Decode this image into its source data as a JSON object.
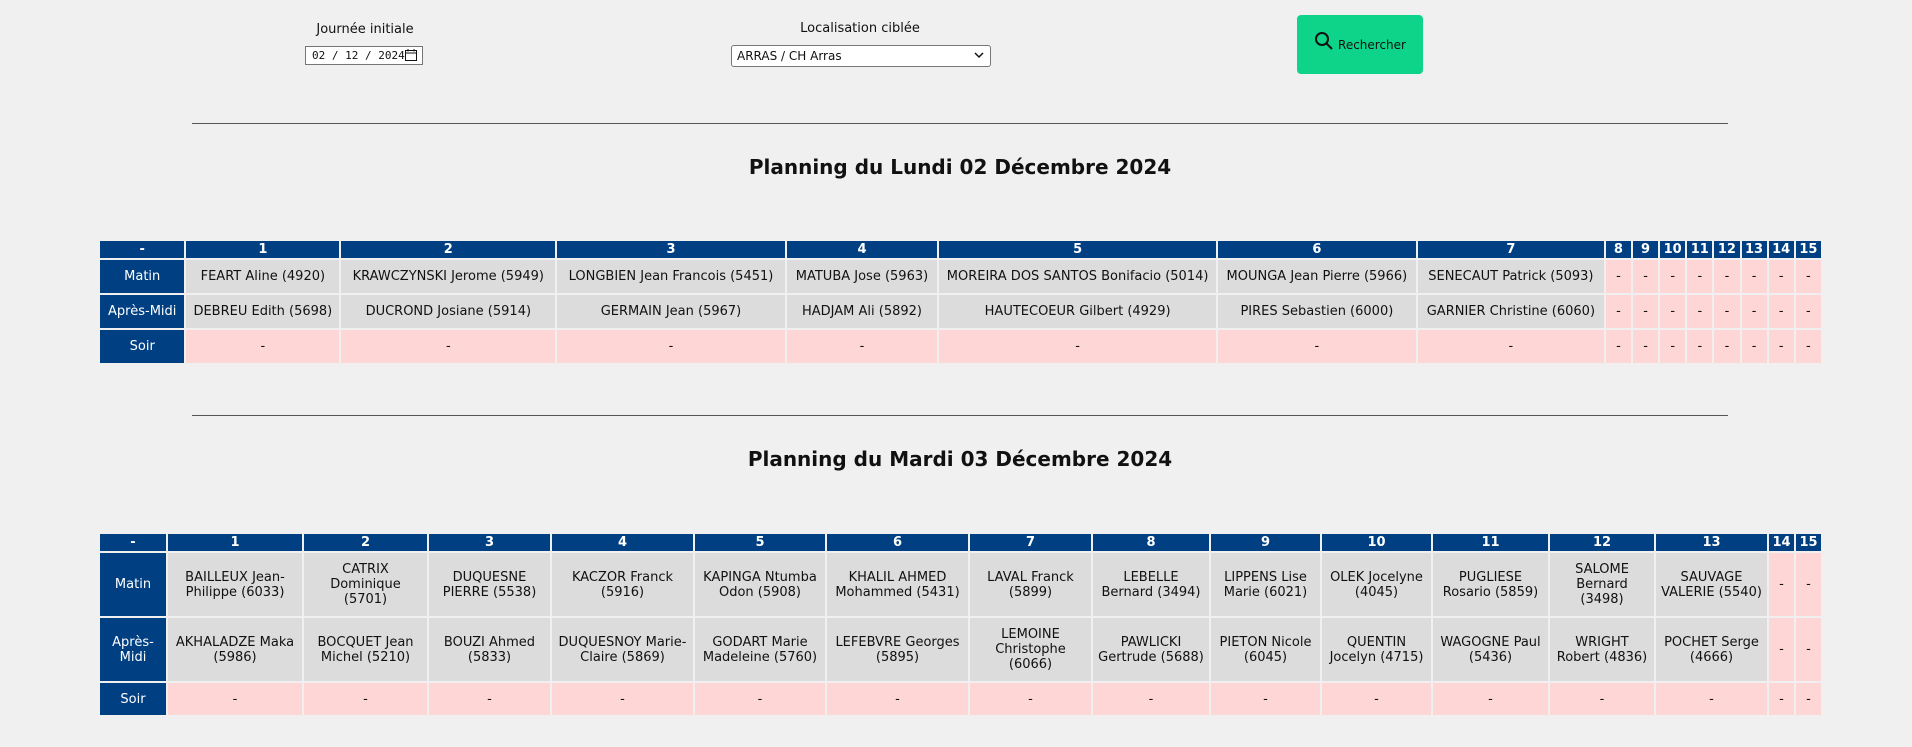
{
  "filters": {
    "date_label": "Journée initiale",
    "date_value": "02 / 12 / 2024",
    "location_label": "Localisation ciblée",
    "location_value": "ARRAS / CH Arras",
    "search_label": "Rechercher"
  },
  "plannings": [
    {
      "title": "Planning du Lundi 02 Décembre 2024",
      "corner": "-",
      "columns": [
        "1",
        "2",
        "3",
        "4",
        "5",
        "6",
        "7",
        "8",
        "9",
        "10",
        "11",
        "12",
        "13",
        "14",
        "15"
      ],
      "col_widths": [
        152,
        213,
        226,
        150,
        275,
        197,
        185,
        25,
        25,
        25,
        25,
        25,
        25,
        25,
        25
      ],
      "rows": [
        {
          "label": "Matin",
          "cells": [
            "FEART Aline (4920)",
            "KRAWCZYNSKI Jerome (5949)",
            "LONGBIEN Jean Francois (5451)",
            "MATUBA Jose (5963)",
            "MOREIRA DOS SANTOS Bonifacio (5014)",
            "MOUNGA Jean Pierre (5966)",
            "SENECAUT Patrick (5093)",
            "-",
            "-",
            "-",
            "-",
            "-",
            "-",
            "-",
            "-"
          ]
        },
        {
          "label": "Après-Midi",
          "cells": [
            "DEBREU Edith (5698)",
            "DUCROND Josiane (5914)",
            "GERMAIN Jean (5967)",
            "HADJAM Ali (5892)",
            "HAUTECOEUR Gilbert (4929)",
            "PIRES Sebastien (6000)",
            "GARNIER Christine (6060)",
            "-",
            "-",
            "-",
            "-",
            "-",
            "-",
            "-",
            "-"
          ]
        },
        {
          "label": "Soir",
          "cells": [
            "-",
            "-",
            "-",
            "-",
            "-",
            "-",
            "-",
            "-",
            "-",
            "-",
            "-",
            "-",
            "-",
            "-",
            "-"
          ]
        }
      ]
    },
    {
      "title": "Planning du Mardi 03 Décembre 2024",
      "corner": "-",
      "columns": [
        "1",
        "2",
        "3",
        "4",
        "5",
        "6",
        "7",
        "8",
        "9",
        "10",
        "11",
        "12",
        "13",
        "14",
        "15"
      ],
      "col_widths": [
        134,
        123,
        121,
        141,
        130,
        141,
        121,
        116,
        109,
        109,
        115,
        104,
        111,
        112,
        25,
        25
      ],
      "rows": [
        {
          "label": "Matin",
          "cells": [
            "BAILLEUX Jean-Philippe (6033)",
            "CATRIX Dominique (5701)",
            "DUQUESNE PIERRE (5538)",
            "KACZOR Franck (5916)",
            "KAPINGA Ntumba Odon (5908)",
            "KHALIL AHMED Mohammed (5431)",
            "LAVAL Franck (5899)",
            "LEBELLE Bernard (3494)",
            "LIPPENS Lise Marie (6021)",
            "OLEK Jocelyne (4045)",
            "PUGLIESE Rosario (5859)",
            "SALOME Bernard (3498)",
            "SAUVAGE VALERIE (5540)",
            "-",
            "-"
          ]
        },
        {
          "label": "Après-Midi",
          "cells": [
            "AKHALADZE Maka (5986)",
            "BOCQUET Jean Michel (5210)",
            "BOUZI Ahmed (5833)",
            "DUQUESNOY Marie-Claire (5869)",
            "GODART Marie Madeleine (5760)",
            "LEFEBVRE Georges (5895)",
            "LEMOINE Christophe (6066)",
            "PAWLICKI Gertrude (5688)",
            "PIETON Nicole (6045)",
            "QUENTIN Jocelyn (4715)",
            "WAGOGNE Paul (5436)",
            "WRIGHT Robert (4836)",
            "POCHET Serge (4666)",
            "-",
            "-"
          ]
        },
        {
          "label": "Soir",
          "cells": [
            "-",
            "-",
            "-",
            "-",
            "-",
            "-",
            "-",
            "-",
            "-",
            "-",
            "-",
            "-",
            "-",
            "-",
            "-"
          ]
        }
      ]
    }
  ]
}
